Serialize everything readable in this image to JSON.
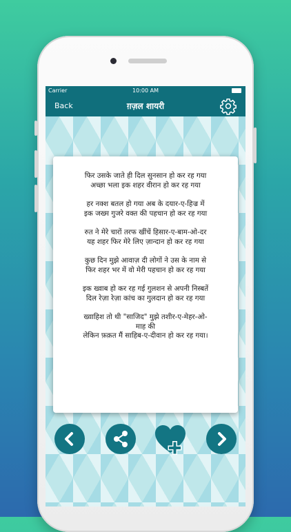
{
  "status_bar": {
    "carrier": "Carrier",
    "time": "10:00 AM"
  },
  "nav": {
    "back_label": "Back",
    "title": "ग़ज़ल शायरी",
    "settings_icon": "gear-icon"
  },
  "poem": {
    "stanzas": [
      [
        "फिर उसके जाते ही दिल सुनसान हो कर रह गया",
        "अच्छा भला इक शहर वीरान हो कर रह गया"
      ],
      [
        "हर नक्श बतल हो गया अब के दयार-ए-हिज्र में",
        "इक जख्म गुजरे वक्त की पहचान हो कर रह गया"
      ],
      [
        "रुत ने मेरे चारों तरफ खींचें हिसार-ए-बाम-ओ-दर",
        "यह शहर फिर मेरे लिए ज़ान्दान हो कर रह गया"
      ],
      [
        "कुछ दिन मुझे आवाज़ दी लोगों ने उस के नाम से",
        "फिर शहर भर में वो मेरी पहचान हो कर रह गया"
      ],
      [
        "इक ख्वाब हो कर रह गई गुलशन से अपनी निस्बतें",
        "दिल रेज़ा रेज़ा कांच का गुलदान हो कर रह गया"
      ],
      [
        "ख्वाहिश तो थी \"साजिद\" मुझे तशीर-ए-मेहर-ओ-",
        "माह की",
        "लेकिन फ़क़त मैं साहिब-ए-दीवान हो कर रह गया।"
      ]
    ]
  },
  "controls": {
    "previous_icon": "chevron-left-icon",
    "share_icon": "share-icon",
    "favorite_icon": "heart-plus-icon",
    "next_icon": "chevron-right-icon"
  },
  "colors": {
    "header": "#106f7c",
    "button": "#137583",
    "text": "#222222"
  }
}
